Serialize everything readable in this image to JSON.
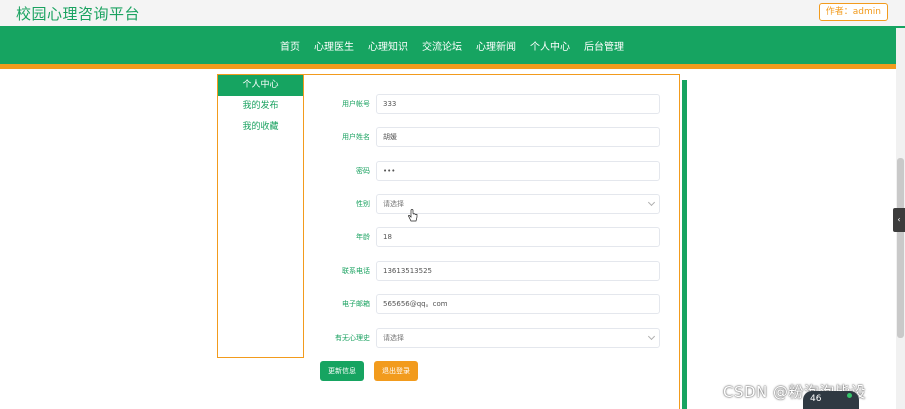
{
  "site": {
    "title": "校园心理咨询平台",
    "author_badge": "作者：admin"
  },
  "nav": {
    "items": [
      "首页",
      "心理医生",
      "心理知识",
      "交流论坛",
      "心理新闻",
      "个人中心",
      "后台管理"
    ]
  },
  "sidebar": {
    "items": [
      {
        "label": "个人中心",
        "active": true
      },
      {
        "label": "我的发布",
        "active": false
      },
      {
        "label": "我的收藏",
        "active": false
      }
    ]
  },
  "form": {
    "account": {
      "label": "用户帐号",
      "value": "333"
    },
    "name": {
      "label": "用户姓名",
      "value": "胡媛"
    },
    "password": {
      "label": "密码",
      "value": "•••"
    },
    "gender": {
      "label": "性别",
      "value": "请选择"
    },
    "age": {
      "label": "年龄",
      "value": "18"
    },
    "phone": {
      "label": "联系电话",
      "value": "13613513525"
    },
    "email": {
      "label": "电子邮箱",
      "value": "565656@qq。com"
    },
    "history": {
      "label": "有无心理史",
      "value": "请选择"
    },
    "update_button": "更新信息",
    "logout_button": "退出登录"
  },
  "watermark": "CSDN @粉泡泡毕设",
  "overlay_badge": "46",
  "colors": {
    "primary": "#16a461",
    "accent": "#f29b1d"
  },
  "icons": {
    "cursor": "hand-pointer-icon",
    "select": "chevron-down-icon",
    "side_tab": "chevron-left-icon"
  }
}
